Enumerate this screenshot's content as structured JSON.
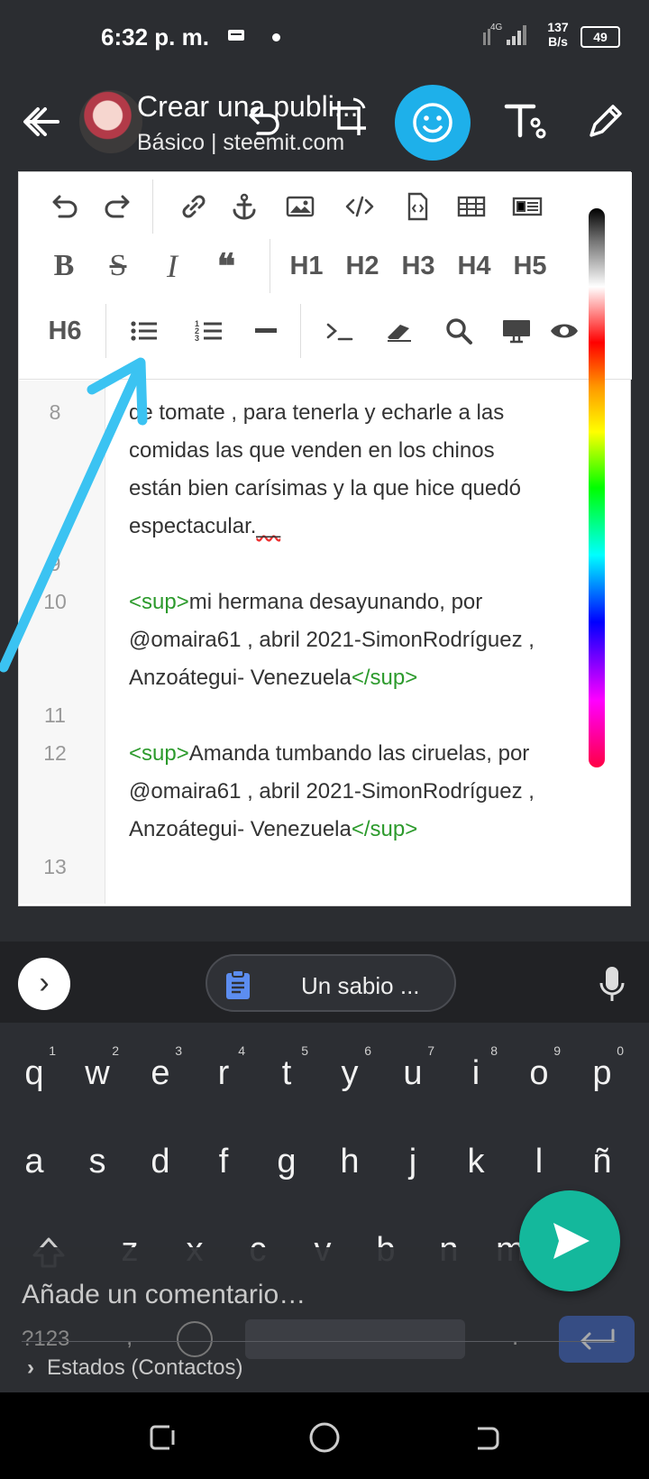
{
  "status_bar": {
    "time": "6:32 p. m.",
    "network": "4G",
    "speed_value": "137",
    "speed_unit": "B/s",
    "battery": "49"
  },
  "header": {
    "title": "Crear una publi...",
    "subtitle": "Básico | steemit.com",
    "accent_color": "#1eb0ea"
  },
  "toolbar": {
    "row1": [
      "undo-icon",
      "redo-icon",
      "link-icon",
      "anchor-icon",
      "image-icon",
      "code-icon",
      "code-file-icon",
      "table-icon",
      "html-block-icon"
    ],
    "headings": [
      "H1",
      "H2",
      "H3",
      "H4",
      "H5",
      "H6"
    ],
    "bold": "B",
    "strike": "S",
    "italic": "I",
    "quote": "❝"
  },
  "editor": {
    "line_numbers": [
      "8",
      "9",
      "10",
      "11",
      "12",
      "13"
    ],
    "lines": {
      "l8a": "de tomate , para tenerla  y echarle a las",
      "l8b": "comidas las que venden en los chinos",
      "l8c": "están  bien carísimas y la que hice quedó",
      "l8d": "espectacular.",
      "l8d_squig": "__",
      "l10_open": "<sup>",
      "l10a": "mi hermana desayunando, por",
      "l10b": "@omaira61 , abril 2021-SimonRodríguez ,",
      "l10c": "Anzoátegui- Venezuela",
      "l10_close": "</sup>",
      "l12_open": "<sup>",
      "l12a": "Amanda tumbando las ciruelas, por",
      "l12b": "@omaira61 , abril 2021-SimonRodríguez ,",
      "l12c": "Anzoátegui- Venezuela",
      "l12_close": "</sup>"
    },
    "tag_color": "#2c9a2c"
  },
  "keyboard": {
    "suggestion": "Un sabio ...",
    "row1": [
      {
        "k": "q",
        "n": "1"
      },
      {
        "k": "w",
        "n": "2"
      },
      {
        "k": "e",
        "n": "3"
      },
      {
        "k": "r",
        "n": "4"
      },
      {
        "k": "t",
        "n": "5"
      },
      {
        "k": "y",
        "n": "6"
      },
      {
        "k": "u",
        "n": "7"
      },
      {
        "k": "i",
        "n": "8"
      },
      {
        "k": "o",
        "n": "9"
      },
      {
        "k": "p",
        "n": "0"
      }
    ],
    "row2": [
      "a",
      "s",
      "d",
      "f",
      "g",
      "h",
      "j",
      "k",
      "l",
      "ñ"
    ],
    "row3": [
      "z",
      "x",
      "c",
      "v",
      "b",
      "n",
      "m"
    ],
    "symbols_key": "?123",
    "comma": ",",
    "period": "."
  },
  "comment": {
    "placeholder": "Añade un comentario…",
    "states": "Estados (Contactos)"
  },
  "fab": {
    "color": "#14b89c"
  }
}
